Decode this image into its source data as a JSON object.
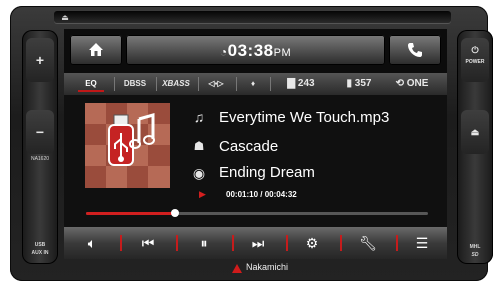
{
  "device": {
    "left_panel": {
      "plus": "+",
      "minus": "−",
      "model": "NA1620",
      "usb_label_1": "USB",
      "usb_label_2": "AUX IN"
    },
    "right_panel": {
      "power_label": "POWER",
      "mhl_label": "MHL",
      "sd_label": "SD"
    },
    "brand": "Nakamichi"
  },
  "topbar": {
    "time": "03:38",
    "ampm": "PM"
  },
  "status": {
    "eq": "EQ",
    "dbss": "DBSS",
    "xbass": "XBASS",
    "folders": "243",
    "files": "357",
    "repeat": "ONE"
  },
  "track": {
    "title": "Everytime We Touch.mp3",
    "artist": "Cascade",
    "album": "Ending Dream",
    "elapsed": "00:01:10",
    "total": "00:04:32",
    "time_display": "00:01:10 / 00:04:32",
    "progress": 0.26
  },
  "colors": {
    "accent": "#d11f1f",
    "screen_bg": "#101010"
  },
  "icons": {
    "home": "home-icon",
    "phone": "phone-icon",
    "clock": "clock-icon",
    "note": "music-note-icon",
    "artist": "artist-icon",
    "album": "disc-icon",
    "play": "play-icon"
  }
}
